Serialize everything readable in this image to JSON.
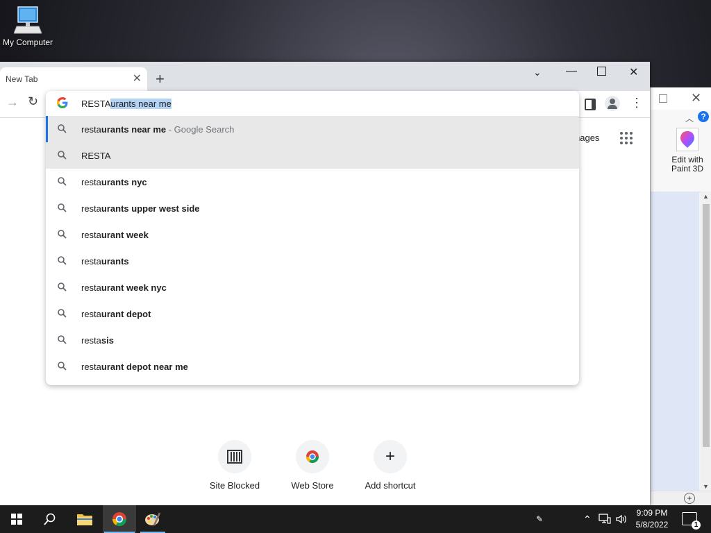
{
  "desktop": {
    "icon_label": "My Computer"
  },
  "background_window": {
    "paint3d_label": "Edit with Paint 3D",
    "help_label": "?"
  },
  "chrome": {
    "tab_title": "New Tab",
    "omnibox": {
      "typed": "RESTA",
      "autocompleted": "urants near me",
      "suggestions": [
        {
          "prefix": "resta",
          "bold": "urants near me",
          "suffix": " - Google Search"
        },
        {
          "prefix": "RESTA",
          "bold": "",
          "suffix": ""
        },
        {
          "prefix": "resta",
          "bold": "urants nyc",
          "suffix": ""
        },
        {
          "prefix": "resta",
          "bold": "urants upper west side",
          "suffix": ""
        },
        {
          "prefix": "resta",
          "bold": "urant week",
          "suffix": ""
        },
        {
          "prefix": "resta",
          "bold": "urants",
          "suffix": ""
        },
        {
          "prefix": "resta",
          "bold": "urant week nyc",
          "suffix": ""
        },
        {
          "prefix": "resta",
          "bold": "urant depot",
          "suffix": ""
        },
        {
          "prefix": "resta",
          "bold": "sis",
          "suffix": ""
        },
        {
          "prefix": "resta",
          "bold": "urant depot near me",
          "suffix": ""
        }
      ]
    },
    "ntp": {
      "images_link": "nages",
      "shortcuts": [
        {
          "label": "Site Blocked"
        },
        {
          "label": "Web Store"
        },
        {
          "label": "Add shortcut"
        }
      ]
    }
  },
  "taskbar": {
    "time": "9:09 PM",
    "date": "5/8/2022",
    "notification_count": "1",
    "pinned": [
      "start",
      "search",
      "file-explorer",
      "chrome",
      "paint"
    ]
  },
  "colors": {
    "accent": "#1a73e8",
    "selection": "#b3d3f4",
    "taskbar": "#1c1c1c"
  }
}
